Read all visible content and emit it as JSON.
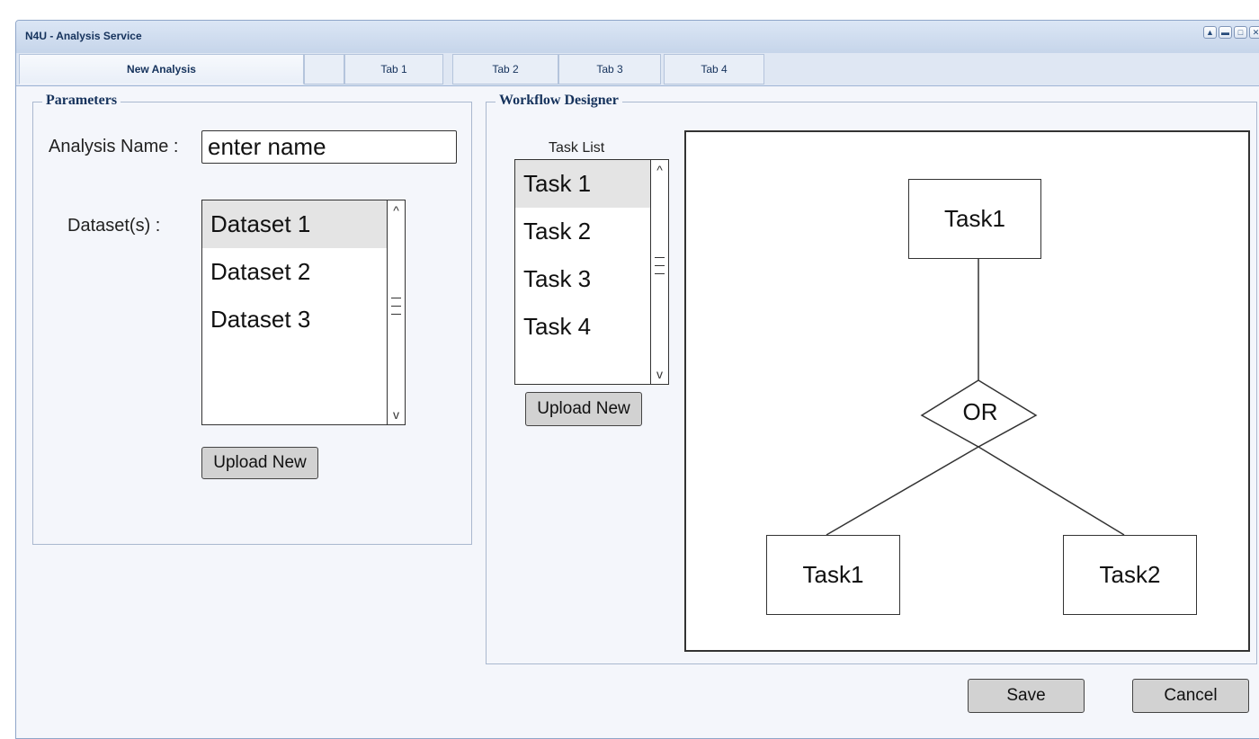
{
  "window": {
    "title": "N4U - Analysis Service",
    "controls": [
      "up-arrow-icon",
      "minimize-icon",
      "maximize-icon",
      "close-icon"
    ]
  },
  "tabs": [
    {
      "label": "New Analysis",
      "active": true
    },
    {
      "label": "",
      "active": false
    },
    {
      "label": "Tab 1",
      "active": false
    },
    {
      "label": "Tab 2",
      "active": false
    },
    {
      "label": "Tab 3",
      "active": false
    },
    {
      "label": "Tab 4",
      "active": false
    }
  ],
  "parameters": {
    "legend": "Parameters",
    "analysis_name_label": "Analysis Name :",
    "analysis_name_value": "enter name",
    "datasets_label": "Dataset(s) :",
    "datasets": [
      "Dataset 1",
      "Dataset 2",
      "Dataset 3"
    ],
    "selected_dataset": "Dataset 1",
    "upload_label": "Upload New"
  },
  "workflow": {
    "legend": "Workflow Designer",
    "task_list_label": "Task List",
    "tasks": [
      "Task 1",
      "Task 2",
      "Task 3",
      "Task 4"
    ],
    "selected_task": "Task 1",
    "upload_label": "Upload New",
    "diagram": {
      "top_node": "Task1",
      "operator": "OR",
      "left_node": "Task1",
      "right_node": "Task2"
    }
  },
  "actions": {
    "save_label": "Save",
    "cancel_label": "Cancel"
  }
}
